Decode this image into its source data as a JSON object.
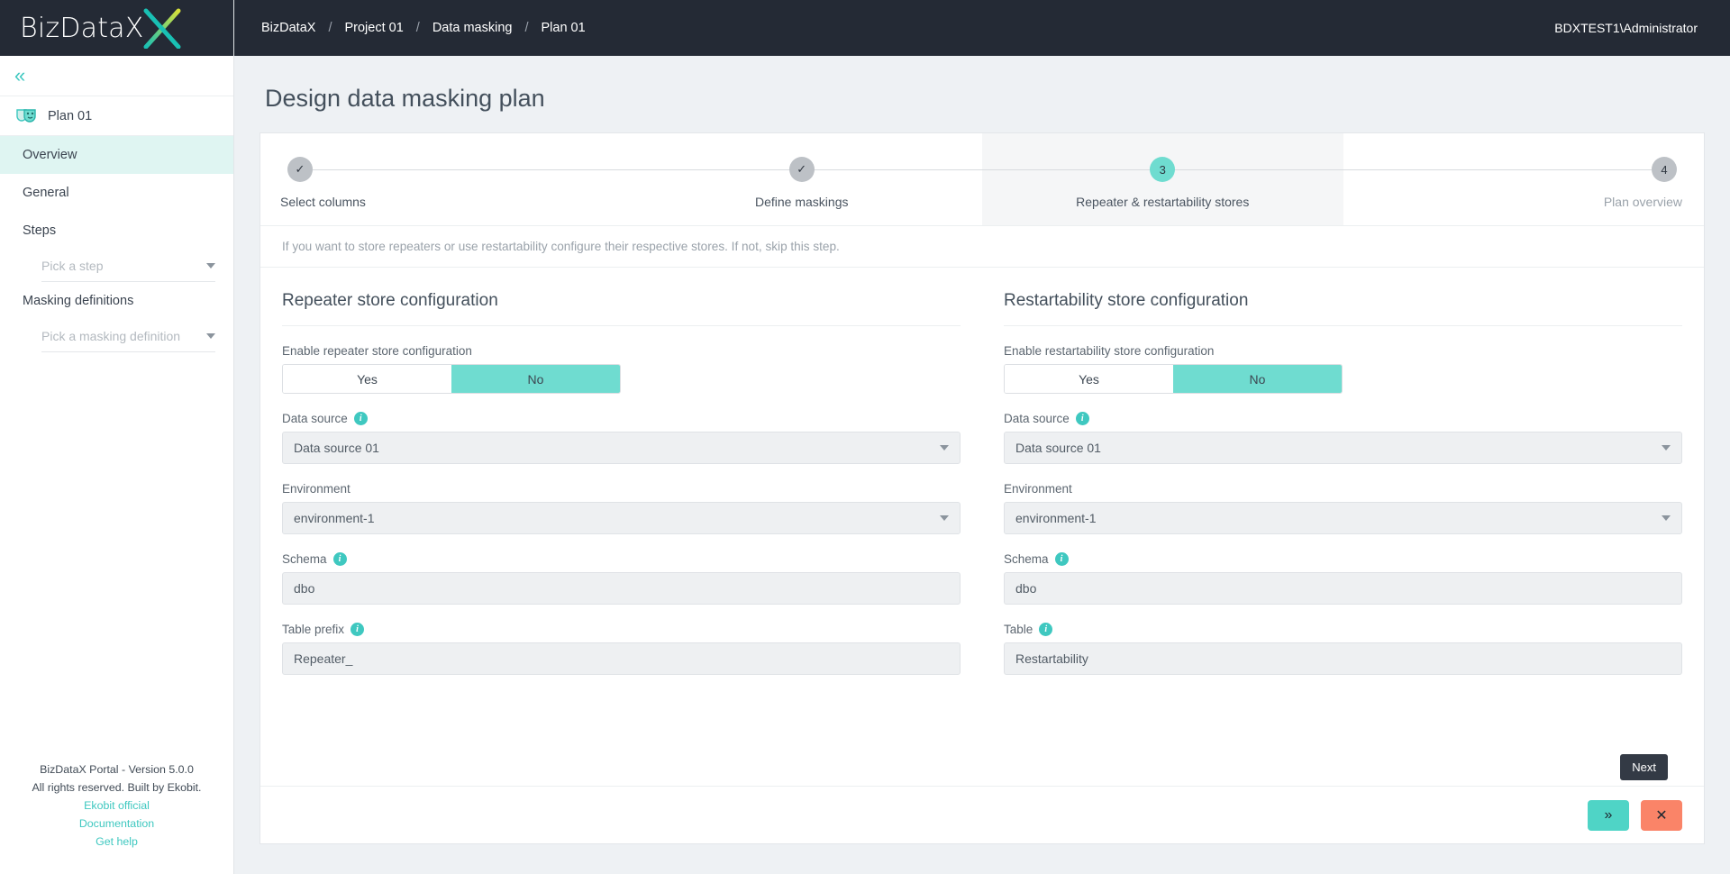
{
  "brand": {
    "name": "BizDataX",
    "logo_icon": "bizdatax-x-logo"
  },
  "sidebar": {
    "collapse_icon": "double-chevron-left-icon",
    "plan": {
      "label": "Plan 01",
      "icon": "theater-masks-icon"
    },
    "items": [
      {
        "label": "Overview",
        "active": true
      },
      {
        "label": "General",
        "active": false
      },
      {
        "label": "Steps",
        "active": false
      }
    ],
    "steps_select": {
      "placeholder": "Pick a step",
      "icon": "chevron-down-icon"
    },
    "masking_group_title": "Masking definitions",
    "masking_select": {
      "placeholder": "Pick a masking definition",
      "icon": "chevron-down-icon"
    },
    "footer": {
      "line1": "BizDataX Portal - Version 5.0.0",
      "line2": "All rights reserved. Built by Ekobit.",
      "link1": "Ekobit official",
      "link2": "Documentation",
      "link3": "Get help"
    }
  },
  "topbar": {
    "breadcrumbs": [
      "BizDataX",
      "Project 01",
      "Data masking",
      "Plan 01"
    ],
    "separator": "/",
    "user": "BDXTEST1\\Administrator"
  },
  "page": {
    "title": "Design data masking plan",
    "info_text": "If you want to store repeaters or use restartability configure their respective stores. If not, skip this step."
  },
  "stepper": {
    "steps": [
      {
        "label": "Select columns",
        "marker": "✓",
        "state": "done"
      },
      {
        "label": "Define maskings",
        "marker": "✓",
        "state": "done"
      },
      {
        "label": "Repeater & restartability stores",
        "marker": "3",
        "state": "active"
      },
      {
        "label": "Plan overview",
        "marker": "4",
        "state": "pending"
      }
    ]
  },
  "repeater": {
    "section_title": "Repeater store configuration",
    "enable_label": "Enable repeater store configuration",
    "toggle": {
      "yes": "Yes",
      "no": "No",
      "selected": "No"
    },
    "data_source": {
      "label": "Data source",
      "value": "Data source 01",
      "info_icon": "info-icon",
      "caret_icon": "chevron-down-icon"
    },
    "environment": {
      "label": "Environment",
      "value": "environment-1",
      "caret_icon": "chevron-down-icon"
    },
    "schema": {
      "label": "Schema",
      "value": "dbo",
      "info_icon": "info-icon"
    },
    "table_prefix": {
      "label": "Table prefix",
      "value": "Repeater_",
      "info_icon": "info-icon"
    }
  },
  "restartability": {
    "section_title": "Restartability store configuration",
    "enable_label": "Enable restartability store configuration",
    "toggle": {
      "yes": "Yes",
      "no": "No",
      "selected": "No"
    },
    "data_source": {
      "label": "Data source",
      "value": "Data source 01",
      "info_icon": "info-icon",
      "caret_icon": "chevron-down-icon"
    },
    "environment": {
      "label": "Environment",
      "value": "environment-1",
      "caret_icon": "chevron-down-icon"
    },
    "schema": {
      "label": "Schema",
      "value": "dbo",
      "info_icon": "info-icon"
    },
    "table": {
      "label": "Table",
      "value": "Restartability",
      "info_icon": "info-icon"
    }
  },
  "actions": {
    "tooltip": "Next",
    "next_label": "»",
    "close_label": "✕"
  },
  "colors": {
    "accent_teal": "#3fc8c0",
    "toggle_teal": "#6fdcd0",
    "danger": "#fa8468",
    "topbar_dark": "#242a35"
  }
}
